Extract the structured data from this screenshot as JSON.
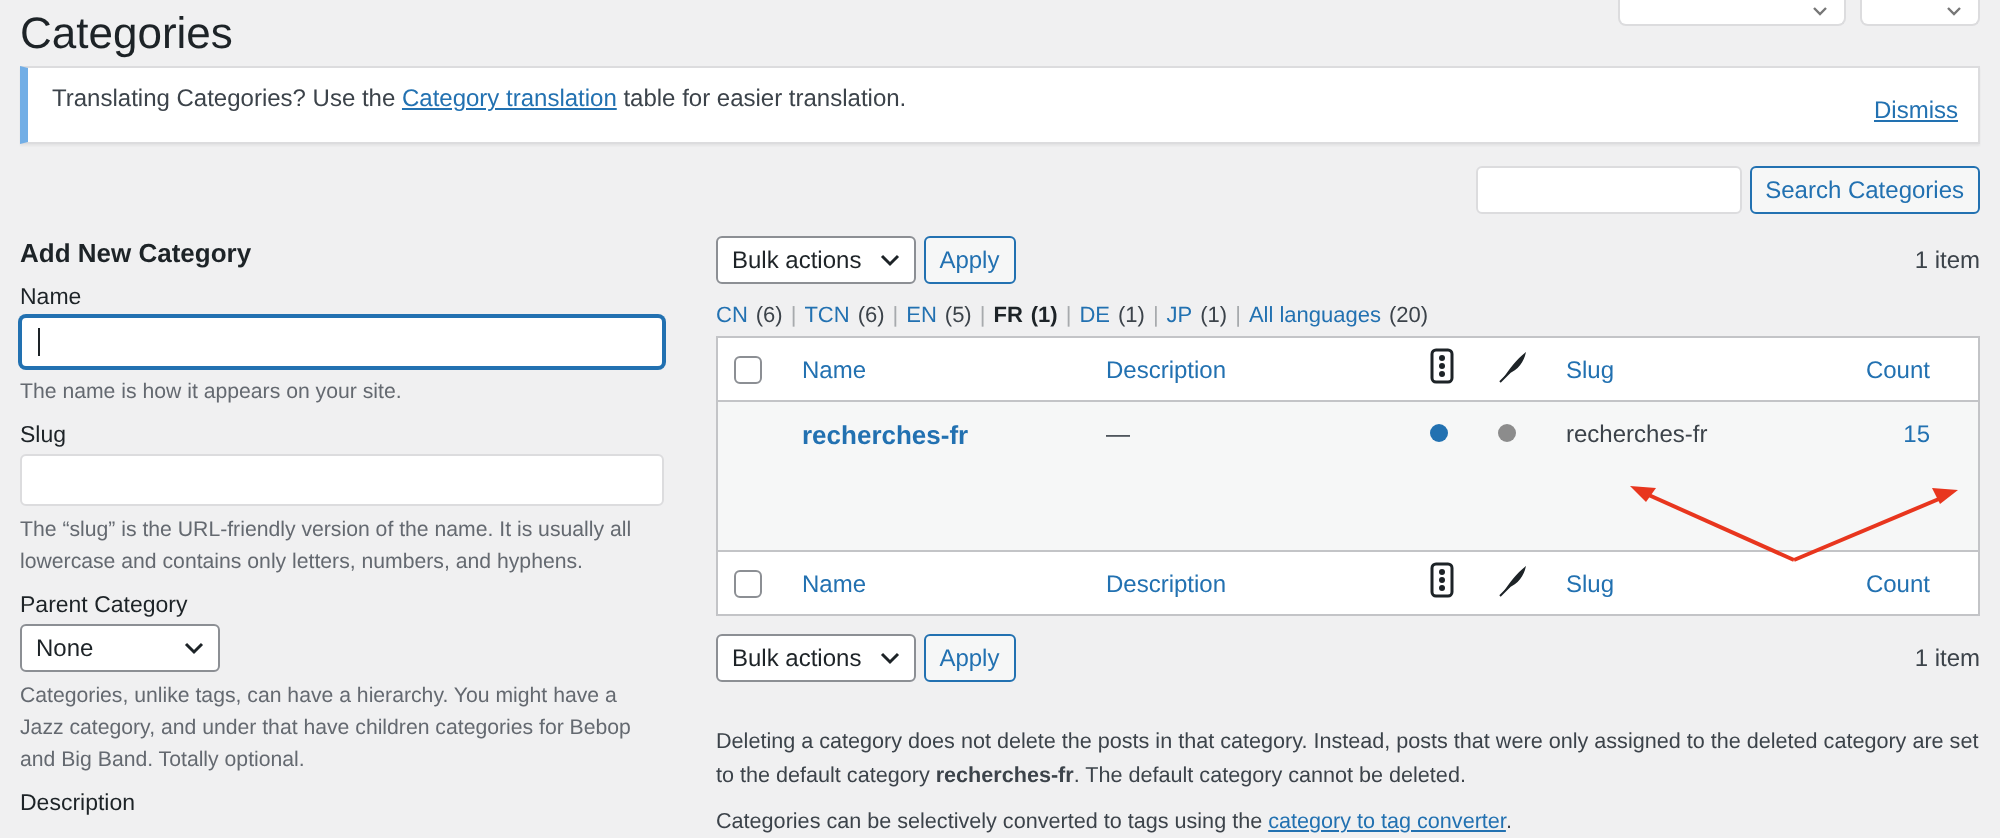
{
  "page_title": "Categories",
  "top_buttons": [
    {
      "kind": "dropdown"
    },
    {
      "kind": "dropdown"
    }
  ],
  "notice": {
    "text": "Translating Categories? Use the ",
    "link": "Category translation",
    "after": " table for easier translation.",
    "dismiss": "Dismiss"
  },
  "search": {
    "button": "Search Categories"
  },
  "add_form": {
    "heading": "Add New Category",
    "fields": [
      {
        "kind": "text",
        "label": "Name",
        "focused": true,
        "help": "The name is how it appears on your site."
      },
      {
        "kind": "text",
        "label": "Slug",
        "focused": false,
        "help": "The “slug” is the URL-friendly version of the name. It is usually all lowercase and contains only letters, numbers, and hyphens."
      },
      {
        "kind": "select",
        "label": "Parent Category",
        "value": "None",
        "help": "Categories, unlike tags, can have a hierarchy. You might have a Jazz category, and under that have children categories for Bebop and Big Band. Totally optional."
      },
      {
        "kind": "label",
        "label": "Description"
      }
    ]
  },
  "bulk_top": {
    "select": "Bulk actions",
    "apply": "Apply",
    "count": "1 item"
  },
  "languages": [
    {
      "label": "CN",
      "count": "(6)",
      "selected": false
    },
    {
      "separator": "|",
      "label": "TCN",
      "count": "(6)",
      "selected": false
    },
    {
      "separator": "|",
      "label": "EN",
      "count": "(5)",
      "selected": false
    },
    {
      "separator": "|",
      "label": "FR",
      "count": "(1)",
      "selected": true
    },
    {
      "separator": "|",
      "label": "DE",
      "count": "(1)",
      "selected": false
    },
    {
      "separator": "|",
      "label": "JP",
      "count": "(1)",
      "selected": false
    },
    {
      "separator": "|",
      "label": "All languages",
      "count": "(20)",
      "selected": false
    }
  ],
  "table": {
    "header": {
      "checked": false,
      "columns": [
        {
          "kind": "text",
          "label": "Name"
        },
        {
          "kind": "text",
          "label": "Description"
        },
        {
          "kind": "icon-lights"
        },
        {
          "kind": "icon-feather"
        },
        {
          "kind": "text",
          "label": "Slug"
        },
        {
          "kind": "count",
          "label": "Count"
        }
      ]
    },
    "footer": {
      "checked": false,
      "columns": [
        {
          "kind": "text",
          "label": "Name"
        },
        {
          "kind": "text",
          "label": "Description"
        },
        {
          "kind": "icon-lights"
        },
        {
          "kind": "icon-feather"
        },
        {
          "kind": "text",
          "label": "Slug"
        },
        {
          "kind": "count",
          "label": "Count"
        }
      ]
    },
    "rows": [
      {
        "name": "recherches-fr",
        "description": "—",
        "dots": [
          {
            "color": "#2271b1"
          },
          {
            "color": "#8c8c8c"
          }
        ],
        "slug": "recherches-fr",
        "count": "15"
      }
    ]
  },
  "bulk_bottom": {
    "select": "Bulk actions",
    "apply": "Apply",
    "count": "1 item"
  },
  "footer_notes": [
    {
      "text": "Deleting a category does not delete the posts in that category. Instead, posts that were only assigned to the deleted category are set to the default category **recherches-fr**. The default category cannot be deleted."
    },
    {
      "text": "Categories can be selectively converted to tags using the ",
      "link": "category to tag converter",
      "after": "."
    }
  ]
}
